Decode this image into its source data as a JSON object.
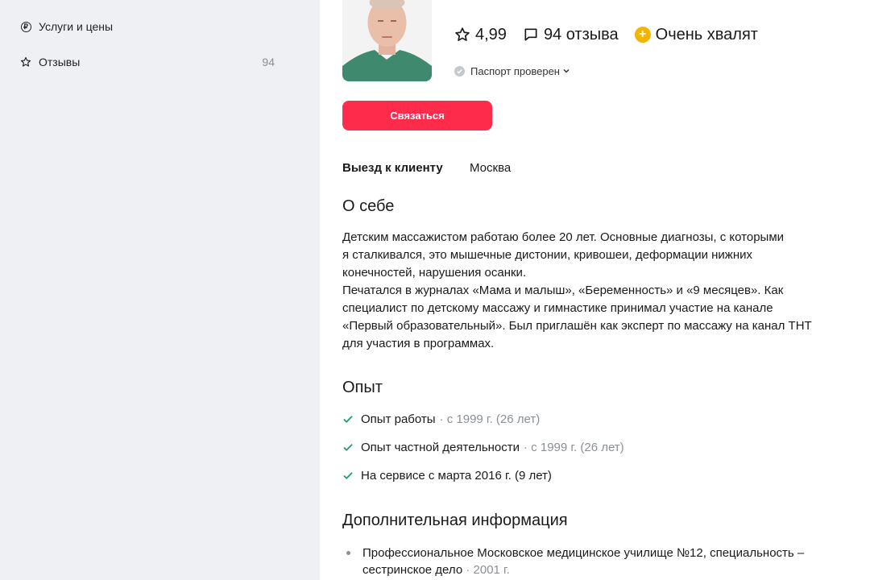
{
  "sidebar": {
    "items": [
      {
        "label": "Услуги и цены",
        "icon": "ruble-icon"
      },
      {
        "label": "Отзывы",
        "icon": "star-outline-icon",
        "count": "94"
      }
    ]
  },
  "profile": {
    "rating": "4,99",
    "reviews": "94 отзыва",
    "praise": "Очень хвалят",
    "passport": "Паспорт проверен"
  },
  "actions": {
    "contact_label": "Связаться"
  },
  "visit": {
    "label": "Выезд к клиенту",
    "value": "Москва"
  },
  "about": {
    "title": "О себе",
    "lines": [
      "Детским массажистом работаю более 20 лет. Основные диагнозы, с которыми",
      "я сталкивался, это мышечные дистонии, кривошеи, деформации нижних",
      "конечностей, нарушения осанки.",
      "Печатался в журналах «Мама и малыш», «Беременность» и «9 месяцев». Как",
      "специалист по детскому массажу и гимнастике принимал участие на канале",
      "«Первый образовательный». Был приглашён как эксперт по массажу на канал ТНТ",
      "для участия в программах."
    ]
  },
  "experience": {
    "title": "Опыт",
    "items": [
      {
        "label": "Опыт работы",
        "detail": "· с 1999 г. (26 лет)"
      },
      {
        "label": "Опыт частной деятельности",
        "detail": "· с 1999 г. (26 лет)"
      },
      {
        "label": "На сервисе с марта 2016 г. (9 лет)",
        "detail": ""
      }
    ]
  },
  "additional": {
    "title": "Дополнительная информация",
    "items": [
      {
        "line1": "Профессиональное Московское медицинское училище №12, специальность –",
        "line2": "сестринское дело",
        "year": "· 2001 г."
      }
    ]
  },
  "colors": {
    "accent": "#ff2b4b",
    "check": "#1a9e6a",
    "muted": "#8a8f98",
    "praise": "#f5b400"
  }
}
